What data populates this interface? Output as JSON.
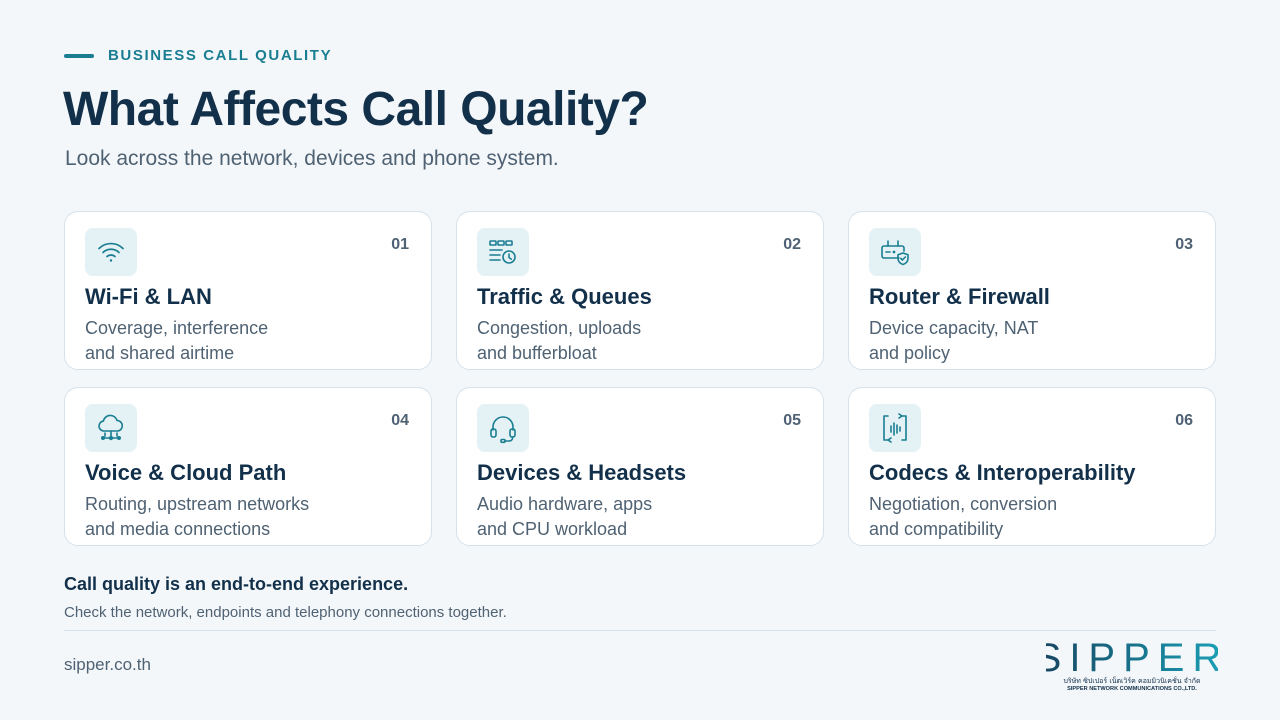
{
  "header": {
    "eyebrow": "BUSINESS CALL QUALITY",
    "title": "What Affects Call Quality?",
    "subtitle": "Look across the network, devices and phone system."
  },
  "cards": [
    {
      "number": "01",
      "icon": "wifi-icon",
      "title": "Wi-Fi & LAN",
      "description": "Coverage, interference\nand shared airtime"
    },
    {
      "number": "02",
      "icon": "queue-clock-icon",
      "title": "Traffic & Queues",
      "description": "Congestion, uploads\nand bufferbloat"
    },
    {
      "number": "03",
      "icon": "router-shield-icon",
      "title": "Router & Firewall",
      "description": "Device capacity, NAT\nand policy"
    },
    {
      "number": "04",
      "icon": "cloud-network-icon",
      "title": "Voice & Cloud Path",
      "description": "Routing, upstream networks\nand media connections"
    },
    {
      "number": "05",
      "icon": "headset-icon",
      "title": "Devices & Headsets",
      "description": "Audio hardware, apps\nand CPU workload"
    },
    {
      "number": "06",
      "icon": "audio-codec-icon",
      "title": "Codecs & Interoperability",
      "description": "Negotiation, conversion\nand compatibility"
    }
  ],
  "footer": {
    "summary": "Call quality is an end-to-end experience.",
    "summary_sub": "Check the network, endpoints and telephony connections together.",
    "website": "sipper.co.th",
    "logo_text": "SIPPER",
    "logo_thai": "บริษัท ซิปเปอร์ เน็ตเวิร์ค คอมมิวนิเคชั่น จำกัด",
    "logo_company": "SIPPER NETWORK COMMUNICATIONS CO.,LTD."
  },
  "colors": {
    "accent": "#1a7e92",
    "heading": "#12304a",
    "body_text": "#4f6273",
    "icon_bg": "#e4f1f5",
    "background": "#f4f7fa"
  }
}
